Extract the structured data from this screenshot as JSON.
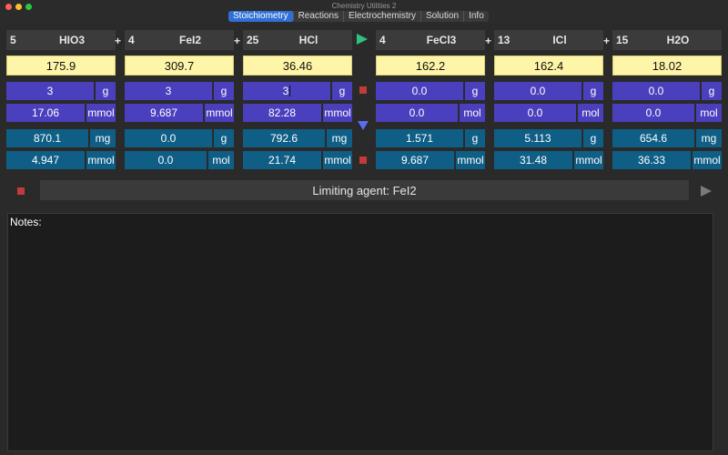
{
  "window": {
    "title": "Chemistry Utilities 2"
  },
  "tabs": [
    {
      "label": "Stoichiometry",
      "active": true
    },
    {
      "label": "Reactions",
      "active": false
    },
    {
      "label": "Electrochemistry",
      "active": false
    },
    {
      "label": "Solution",
      "active": false
    },
    {
      "label": "Info",
      "active": false
    }
  ],
  "reactants": [
    {
      "coef": "5",
      "formula": "HIO3",
      "molar_mass": "175.9",
      "in_mass": "3",
      "in_mass_unit": "g",
      "in_amount": "17.06",
      "in_amount_unit": "mmol",
      "out_mass": "870.1",
      "out_mass_unit": "mg",
      "out_amount": "4.947",
      "out_amount_unit": "mmol"
    },
    {
      "coef": "4",
      "formula": "FeI2",
      "molar_mass": "309.7",
      "in_mass": "3",
      "in_mass_unit": "g",
      "in_amount": "9.687",
      "in_amount_unit": "mmol",
      "out_mass": "0.0",
      "out_mass_unit": "g",
      "out_amount": "0.0",
      "out_amount_unit": "mol"
    },
    {
      "coef": "25",
      "formula": "HCl",
      "molar_mass": "36.46",
      "in_mass": "3",
      "in_mass_unit": "g",
      "in_amount": "82.28",
      "in_amount_unit": "mmol",
      "out_mass": "792.6",
      "out_mass_unit": "mg",
      "out_amount": "21.74",
      "out_amount_unit": "mmol"
    }
  ],
  "products": [
    {
      "coef": "4",
      "formula": "FeCl3",
      "molar_mass": "162.2",
      "in_mass": "0.0",
      "in_mass_unit": "g",
      "in_amount": "0.0",
      "in_amount_unit": "mol",
      "out_mass": "1.571",
      "out_mass_unit": "g",
      "out_amount": "9.687",
      "out_amount_unit": "mmol"
    },
    {
      "coef": "13",
      "formula": "ICl",
      "molar_mass": "162.4",
      "in_mass": "0.0",
      "in_mass_unit": "g",
      "in_amount": "0.0",
      "in_amount_unit": "mol",
      "out_mass": "5.113",
      "out_mass_unit": "g",
      "out_amount": "31.48",
      "out_amount_unit": "mmol"
    },
    {
      "coef": "15",
      "formula": "H2O",
      "molar_mass": "18.02",
      "in_mass": "0.0",
      "in_mass_unit": "g",
      "in_amount": "0.0",
      "in_amount_unit": "mol",
      "out_mass": "654.6",
      "out_mass_unit": "mg",
      "out_amount": "36.33",
      "out_amount_unit": "mmol"
    }
  ],
  "plus_sign": "+",
  "limiting": {
    "text": "Limiting agent: FeI2"
  },
  "notes": {
    "label": "Notes:"
  },
  "icons": {
    "calculate": "play-icon",
    "stop": "stop-icon",
    "down": "down-arrow-icon"
  },
  "colors": {
    "input_row": "#4a3fbd",
    "output_row": "#0f5e86",
    "molar_mass_bg": "#fff5a8",
    "play": "#2ec27e",
    "stop": "#c23b3b",
    "arrow": "#5d6cf2"
  }
}
